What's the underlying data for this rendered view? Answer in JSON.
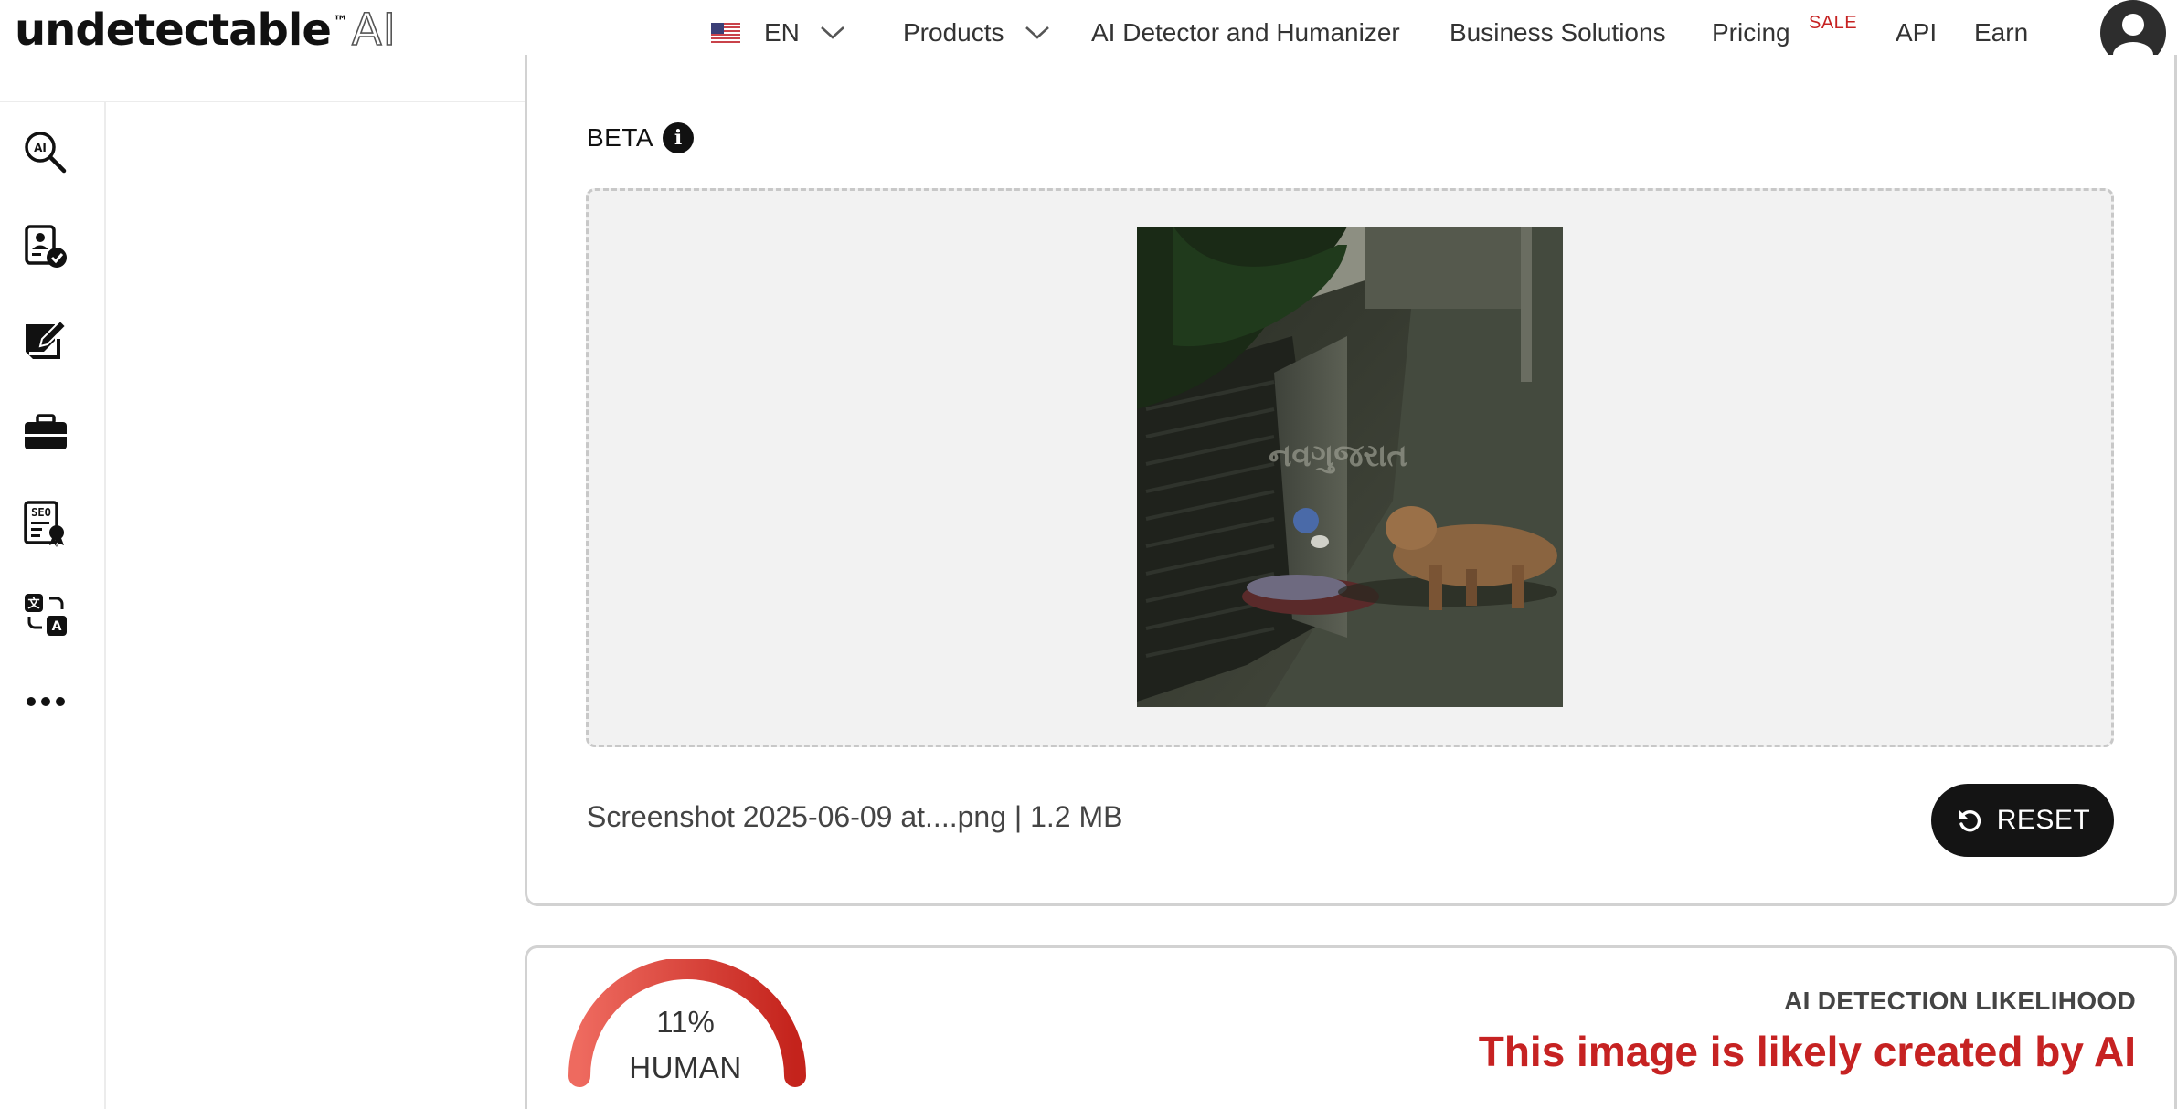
{
  "brand": {
    "name": "undetectable",
    "tm": "™",
    "suffix": "AI"
  },
  "language": {
    "code": "EN",
    "flag_icon": "us-flag-icon"
  },
  "nav": {
    "products": "Products",
    "detector": "AI Detector and Humanizer",
    "business": "Business Solutions",
    "pricing": "Pricing",
    "sale_badge": "SALE",
    "api": "API",
    "earn": "Earn"
  },
  "sidebar": {
    "items": [
      {
        "icon": "ai-detector-search-icon"
      },
      {
        "icon": "profile-verified-icon"
      },
      {
        "icon": "note-edit-icon"
      },
      {
        "icon": "briefcase-icon"
      },
      {
        "icon": "seo-document-icon"
      },
      {
        "icon": "translate-icon"
      },
      {
        "icon": "more-icon"
      }
    ]
  },
  "upload": {
    "beta_label": "BETA",
    "file_info": "Screenshot 2025-06-09 at....png | 1.2 MB",
    "reset_label": "RESET",
    "image_watermark": "નવગુજરાત"
  },
  "result": {
    "percent": "11%",
    "label": "HUMAN",
    "human_fraction": 0.11,
    "title": "AI DETECTION LIKELIHOOD",
    "verdict": "This image is likely created by AI"
  },
  "colors": {
    "verdict": "#c62222",
    "gauge_start": "#ee6a5f",
    "gauge_end": "#c4231c",
    "sale": "#c62222"
  }
}
